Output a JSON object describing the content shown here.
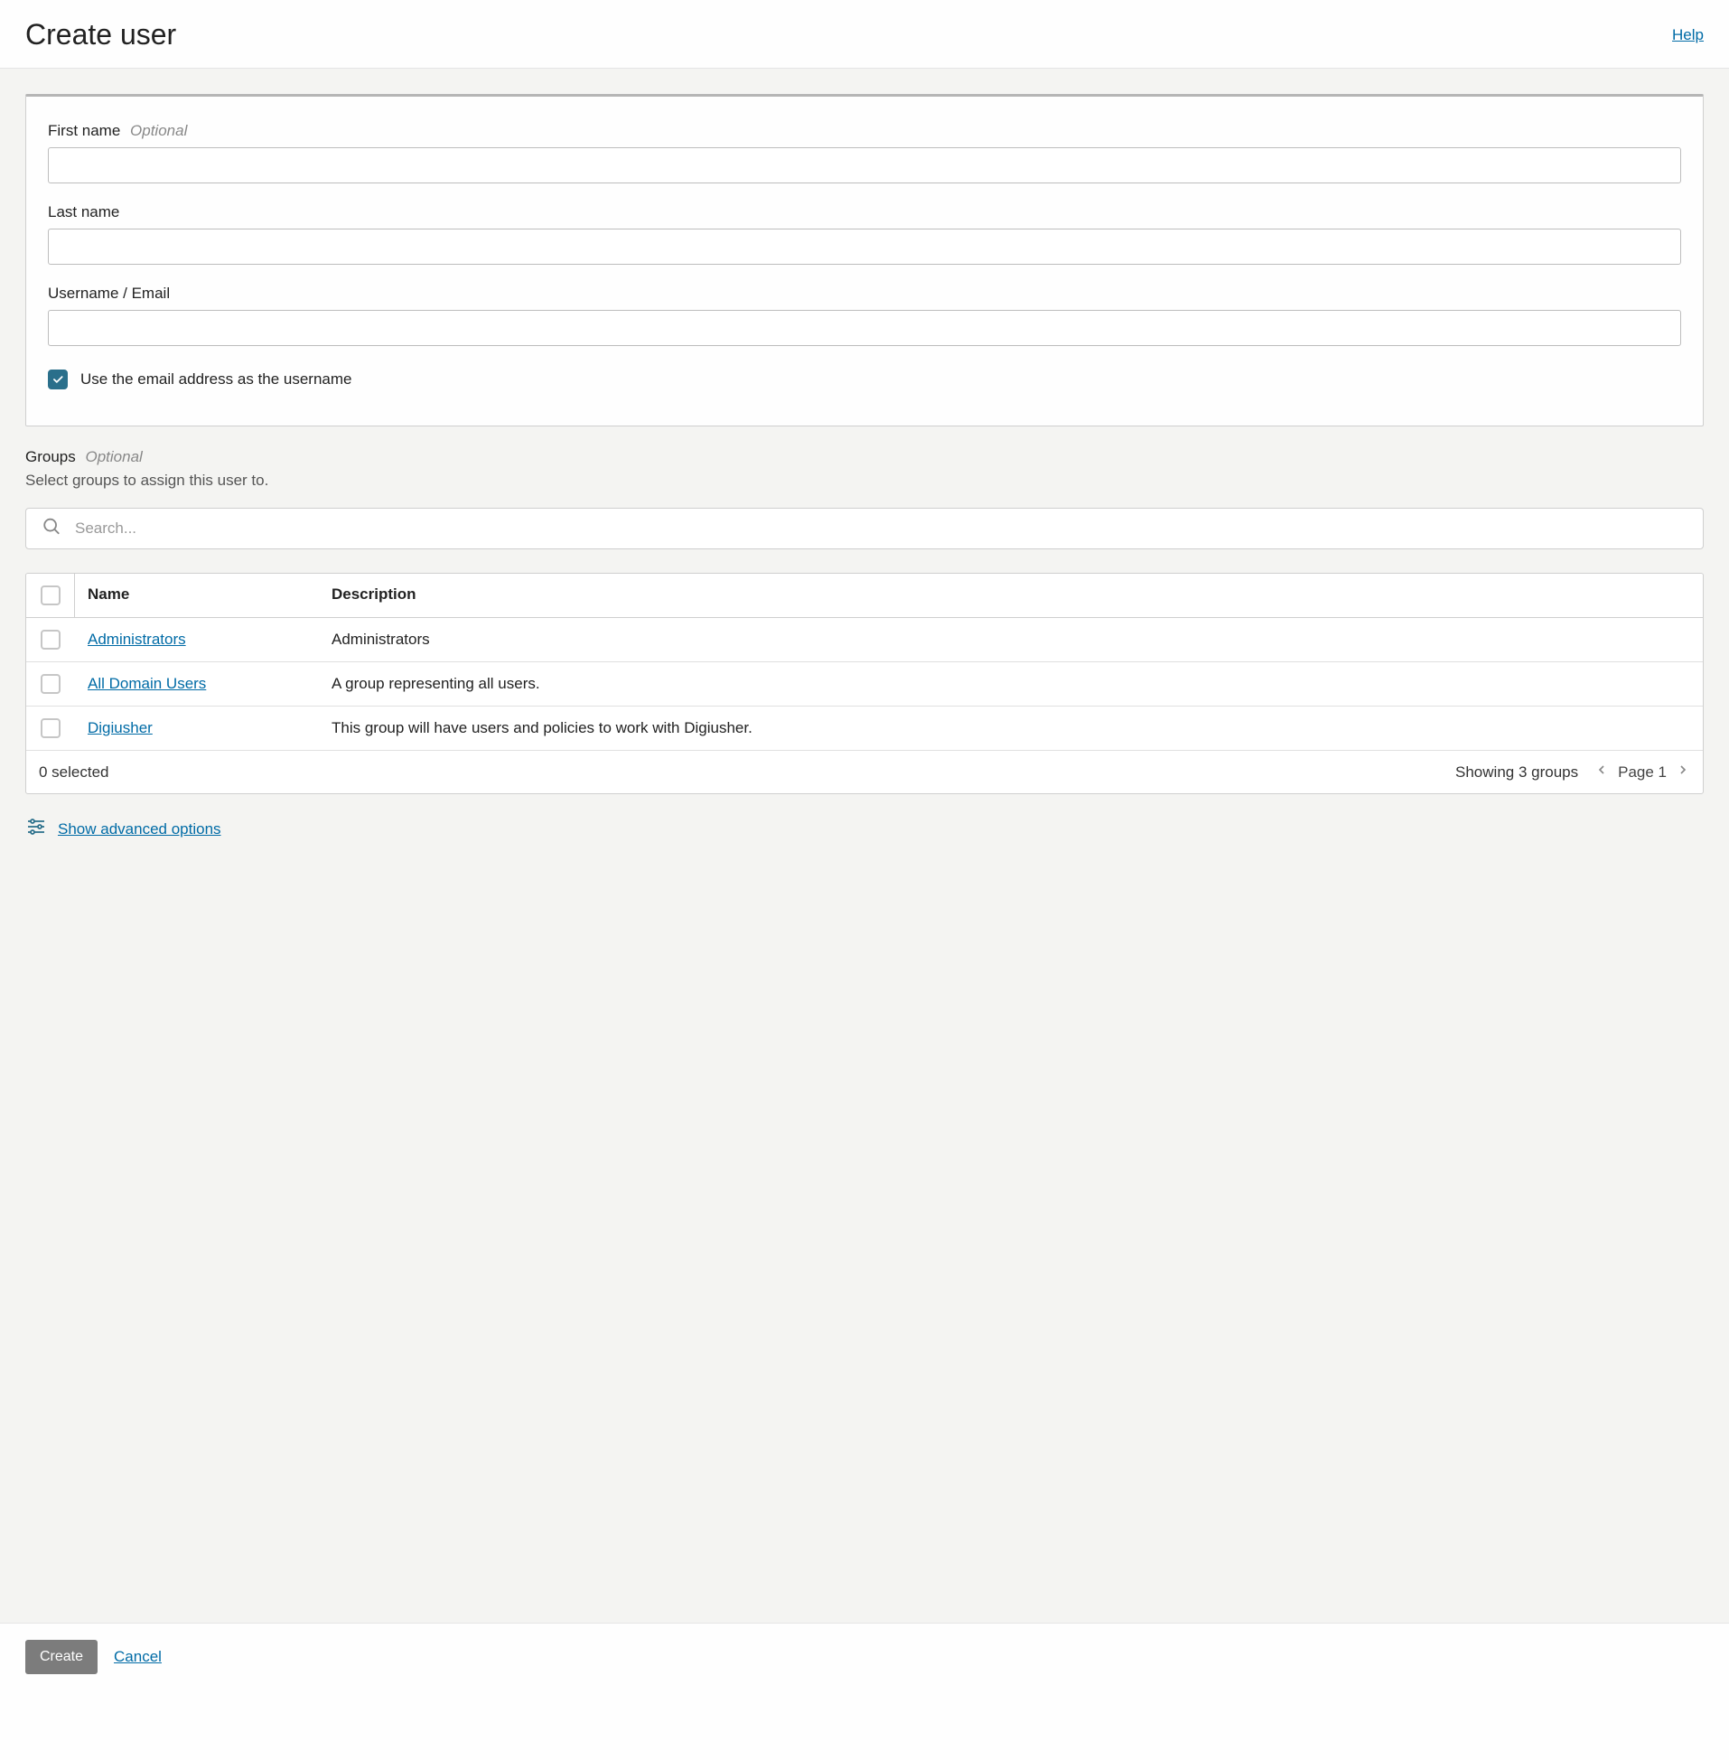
{
  "header": {
    "title": "Create user",
    "help": "Help"
  },
  "form": {
    "first_name_label": "First name",
    "first_name_optional": "Optional",
    "first_name_value": "",
    "last_name_label": "Last name",
    "last_name_value": "",
    "username_label": "Username / Email",
    "username_value": "",
    "use_email_checkbox_label": "Use the email address as the username",
    "use_email_checked": true
  },
  "groups": {
    "label": "Groups",
    "optional": "Optional",
    "description": "Select groups to assign this user to.",
    "search_placeholder": "Search...",
    "columns": {
      "name": "Name",
      "description": "Description"
    },
    "rows": [
      {
        "name": "Administrators",
        "description": "Administrators"
      },
      {
        "name": "All Domain Users",
        "description": "A group representing all users."
      },
      {
        "name": "Digiusher",
        "description": "This group will have users and policies to work with Digiusher."
      }
    ],
    "selected_text": "0 selected",
    "showing_text": "Showing 3 groups",
    "page_text": "Page 1"
  },
  "advanced": {
    "label": "Show advanced options"
  },
  "footer": {
    "create": "Create",
    "cancel": "Cancel"
  }
}
